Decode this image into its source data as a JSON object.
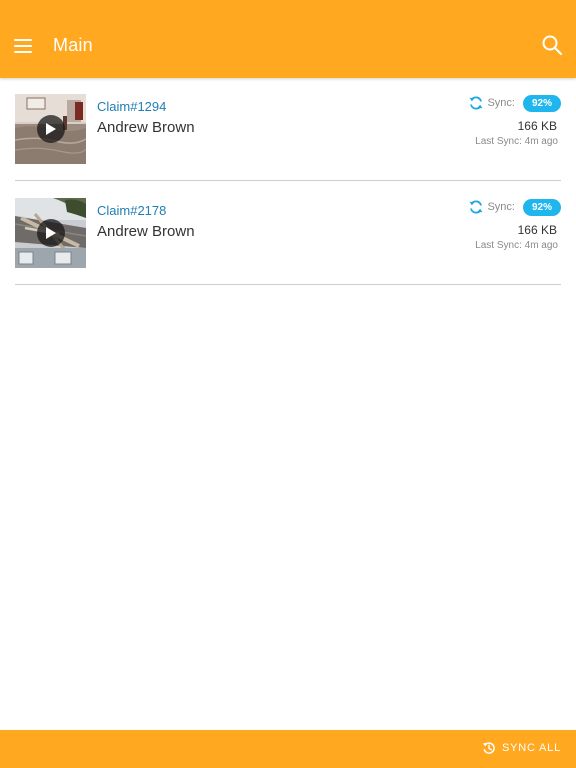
{
  "appbar": {
    "title": "Main",
    "menu_icon": "hamburger-menu-icon",
    "search_icon": "search-icon",
    "color": "#FFA820"
  },
  "claims": [
    {
      "claim_id": "Claim#1294",
      "name": "Andrew Brown",
      "sync_label": "Sync:",
      "progress": "92%",
      "size": "166 KB",
      "last_sync": "Last Sync: 4m ago",
      "thumbnail": "flooded-room-thumbnail"
    },
    {
      "claim_id": "Claim#2178",
      "name": "Andrew Brown",
      "sync_label": "Sync:",
      "progress": "92%",
      "size": "166 KB",
      "last_sync": "Last Sync: 4m ago",
      "thumbnail": "fallen-tree-roof-thumbnail"
    }
  ],
  "footer": {
    "sync_all_label": "SYNC ALL",
    "sync_all_icon": "history-icon"
  },
  "colors": {
    "accent": "#FFA820",
    "link": "#1f7fb4",
    "badge": "#1fb6ee"
  }
}
